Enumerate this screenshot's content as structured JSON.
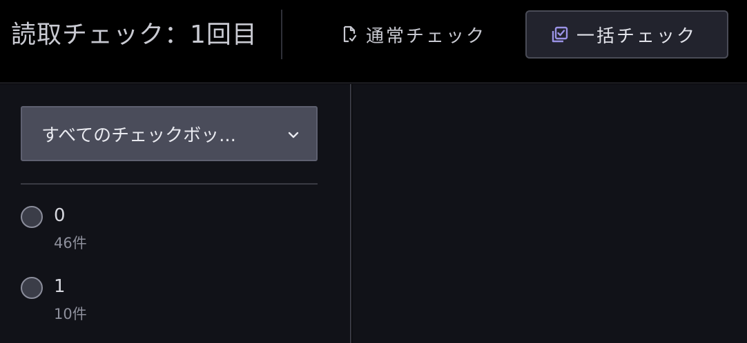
{
  "header": {
    "title": "読取チェック：1回目",
    "modes": [
      {
        "label": "通常チェック",
        "icon": "document-check-icon",
        "active": false
      },
      {
        "label": "一括チェック",
        "icon": "checkbox-check-icon",
        "active": true
      }
    ]
  },
  "sidebar": {
    "filter": {
      "selected": "すべてのチェックボッ..."
    },
    "options": [
      {
        "label": "0",
        "count": "46件"
      },
      {
        "label": "1",
        "count": "10件"
      }
    ]
  },
  "colors": {
    "accent": "#9b93e6",
    "background": "#000000",
    "panel": "#111218"
  }
}
